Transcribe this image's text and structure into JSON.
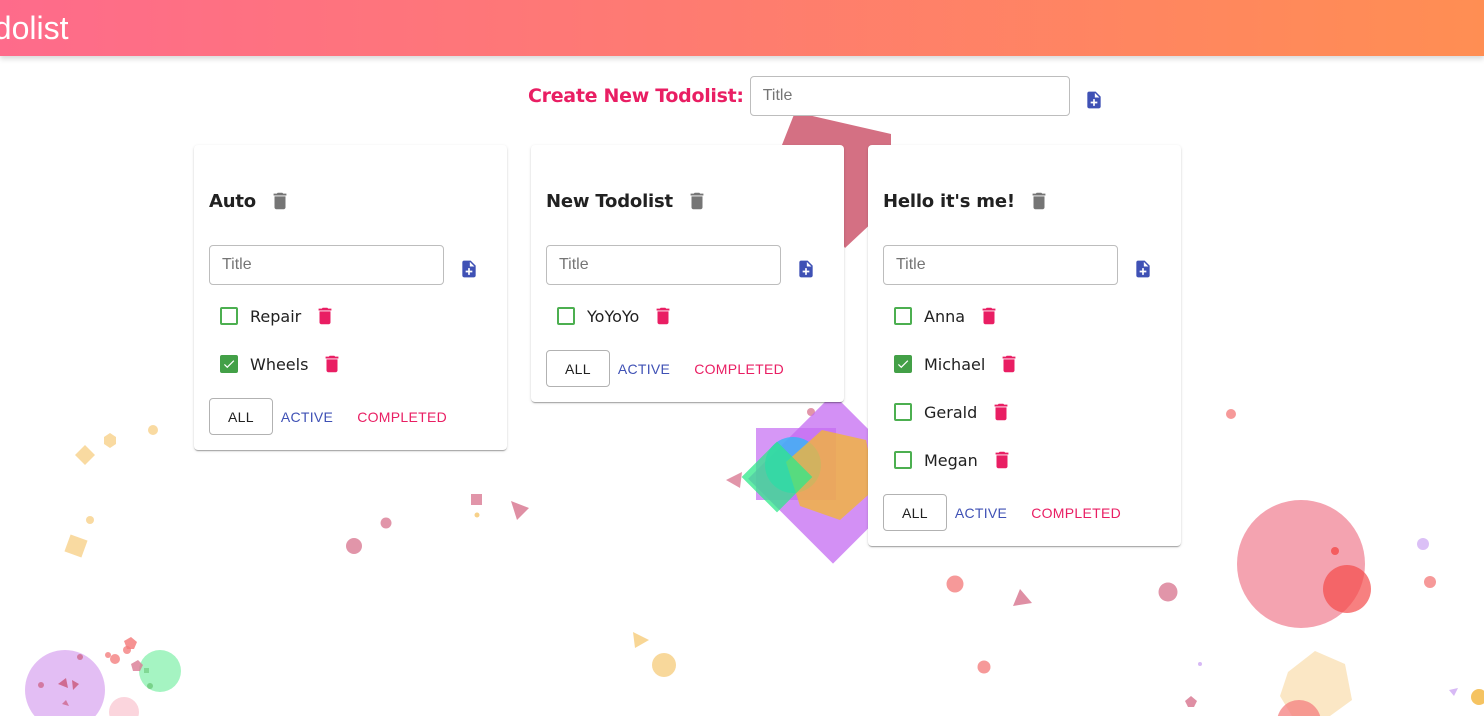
{
  "app": {
    "title": "Todolist"
  },
  "create": {
    "label": "Create New Todolist:",
    "placeholder": "Title",
    "add_icon": "note-add-icon"
  },
  "colors": {
    "appbar_gradient": [
      "#fe6b8b",
      "#ff8e53"
    ],
    "accent_pink": "#e91e63",
    "primary_indigo": "#3f51b5",
    "checkbox_green": "#43a047",
    "delete_gray": "#757575"
  },
  "todolists": [
    {
      "title": "Auto",
      "input_placeholder": "Title",
      "tasks": [
        {
          "title": "Repair",
          "done": false
        },
        {
          "title": "Wheels",
          "done": true
        }
      ],
      "filters": {
        "all": "ALL",
        "active": "ACTIVE",
        "completed": "COMPLETED"
      }
    },
    {
      "title": "New Todolist",
      "input_placeholder": "Title",
      "tasks": [
        {
          "title": "YoYoYo",
          "done": false
        }
      ],
      "filters": {
        "all": "ALL",
        "active": "ACTIVE",
        "completed": "COMPLETED"
      }
    },
    {
      "title": "Hello it's me!",
      "input_placeholder": "Title",
      "tasks": [
        {
          "title": "Anna",
          "done": false
        },
        {
          "title": "Michael",
          "done": true
        },
        {
          "title": "Gerald",
          "done": false
        },
        {
          "title": "Megan",
          "done": false
        }
      ],
      "filters": {
        "all": "ALL",
        "active": "ACTIVE",
        "completed": "COMPLETED"
      }
    }
  ]
}
